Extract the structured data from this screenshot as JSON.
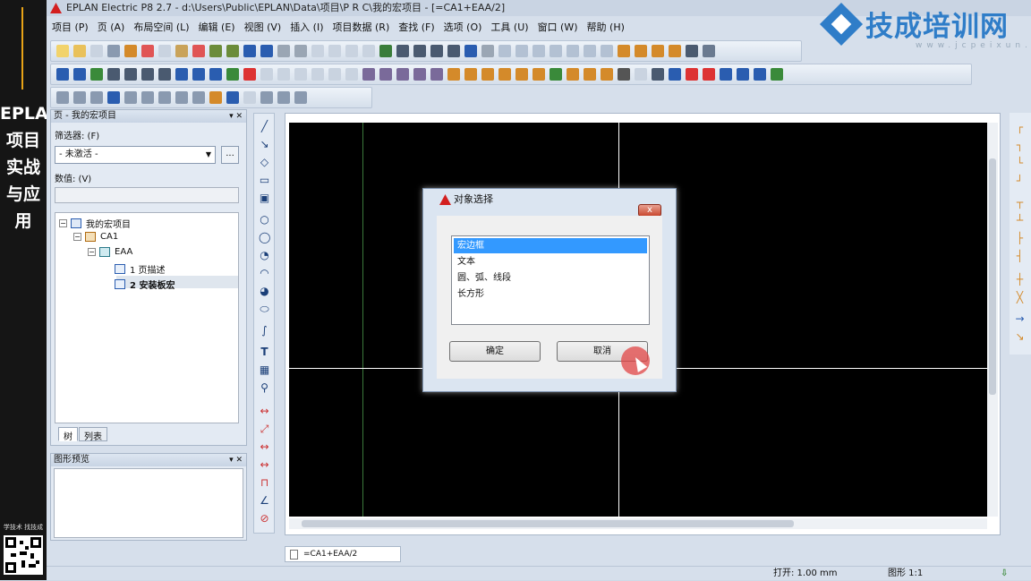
{
  "left_banner": {
    "title": "EPLAN项目实战与应用",
    "small_text": "学技术 找技成"
  },
  "window": {
    "title": "EPLAN Electric P8 2.7 - d:\\Users\\Public\\EPLAN\\Data\\项目\\P R C\\我的宏项目 - [=CA1+EAA/2]"
  },
  "menu": [
    "项目 (P)",
    "页 (A)",
    "布局空间 (L)",
    "编辑 (E)",
    "视图 (V)",
    "插入 (I)",
    "项目数据 (R)",
    "查找 (F)",
    "选项 (O)",
    "工具 (U)",
    "窗口 (W)",
    "帮助 (H)"
  ],
  "logo": {
    "text": "技成培训网",
    "url": "www.jcpeixun.com"
  },
  "page_panel": {
    "title": "页 - 我的宏项目",
    "filter_label": "筛选器: (F)",
    "filter_value": "- 未激活 -",
    "filter_button": "...",
    "value_label": "数值: (V)",
    "tree": [
      {
        "label": "我的宏项目",
        "icon": "project-icon"
      },
      {
        "label": "CA1",
        "icon": "function-icon"
      },
      {
        "label": "EAA",
        "icon": "location-icon"
      },
      {
        "label": "1 页描述",
        "icon": "page-icon"
      },
      {
        "label": "2 安装板宏",
        "icon": "page-icon",
        "selected": true
      }
    ],
    "tabs": [
      "树",
      "列表"
    ]
  },
  "preview_panel": {
    "title": "图形预览"
  },
  "page_tab": {
    "label": "=CA1+EAA/2"
  },
  "status": {
    "open": "打开: 1.00 mm",
    "graphic": "图形 1:1"
  },
  "dialog": {
    "title": "对象选择",
    "close": "x",
    "items": [
      "宏边框",
      "文本",
      "圆、弧、线段",
      "长方形"
    ],
    "selected_index": 0,
    "ok": "确定",
    "cancel": "取消"
  },
  "colors": {
    "canvas": "#000000",
    "accent": "#2f7dc8",
    "selection": "#3399ff"
  }
}
